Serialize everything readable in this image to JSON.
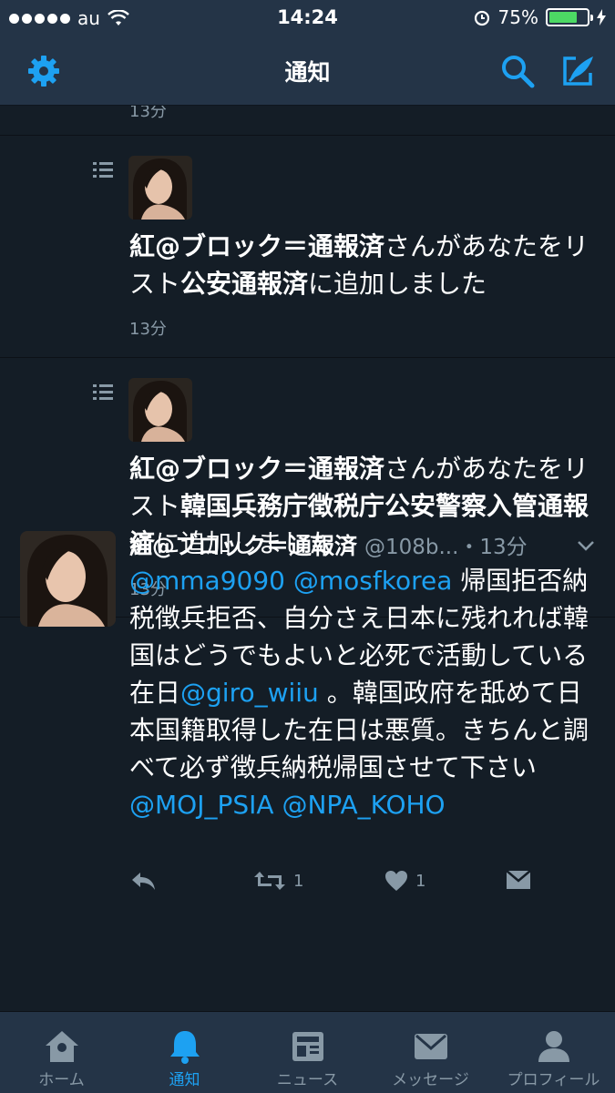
{
  "status_bar": {
    "carrier": "au",
    "time": "14:24",
    "battery_percent": "75%",
    "battery_level": 0.75
  },
  "nav": {
    "title": "通知"
  },
  "feed": {
    "partial_time": "13分",
    "list_notifications": [
      {
        "user": "紅@ブロック＝通報済",
        "text_mid": "さんがあなたをリスト",
        "list_name": "公安通報済",
        "text_end": "に追加しました",
        "time": "13分"
      },
      {
        "user": "紅@ブロック＝通報済",
        "text_mid": "さんがあなたをリスト",
        "list_name": "韓国兵務庁徴税庁公安警察入管通報済",
        "text_end": "に追加しました",
        "time": "13分"
      }
    ],
    "tweet": {
      "name": "紅@ブロック＝通報済",
      "handle": "@108b...",
      "time": "・13分",
      "mention1": "@mma9090",
      "mention2": "@mosfkorea",
      "text1": " 帰国拒否納税徴兵拒否、自分さえ日本に残れれば韓国はどうでもよいと必死で活動している在日",
      "mention3": "@giro_wiiu",
      "text2": " 。韓国政府を舐めて日本国籍取得した在日は悪質。きちんと調べて必ず徴兵納税帰国させて下さい ",
      "mention4": "@MOJ_PSIA",
      "mention5": "@NPA_KOHO",
      "retweet_count": "1",
      "like_count": "1"
    }
  },
  "tabs": [
    {
      "label": "ホーム",
      "icon": "home-icon"
    },
    {
      "label": "通知",
      "icon": "bell-icon"
    },
    {
      "label": "ニュース",
      "icon": "news-icon"
    },
    {
      "label": "メッセージ",
      "icon": "messages-icon"
    },
    {
      "label": "プロフィール",
      "icon": "profile-icon"
    }
  ],
  "colors": {
    "background": "#141d26",
    "bar": "#243447",
    "accent": "#1da1f2",
    "muted": "#8899a6"
  }
}
